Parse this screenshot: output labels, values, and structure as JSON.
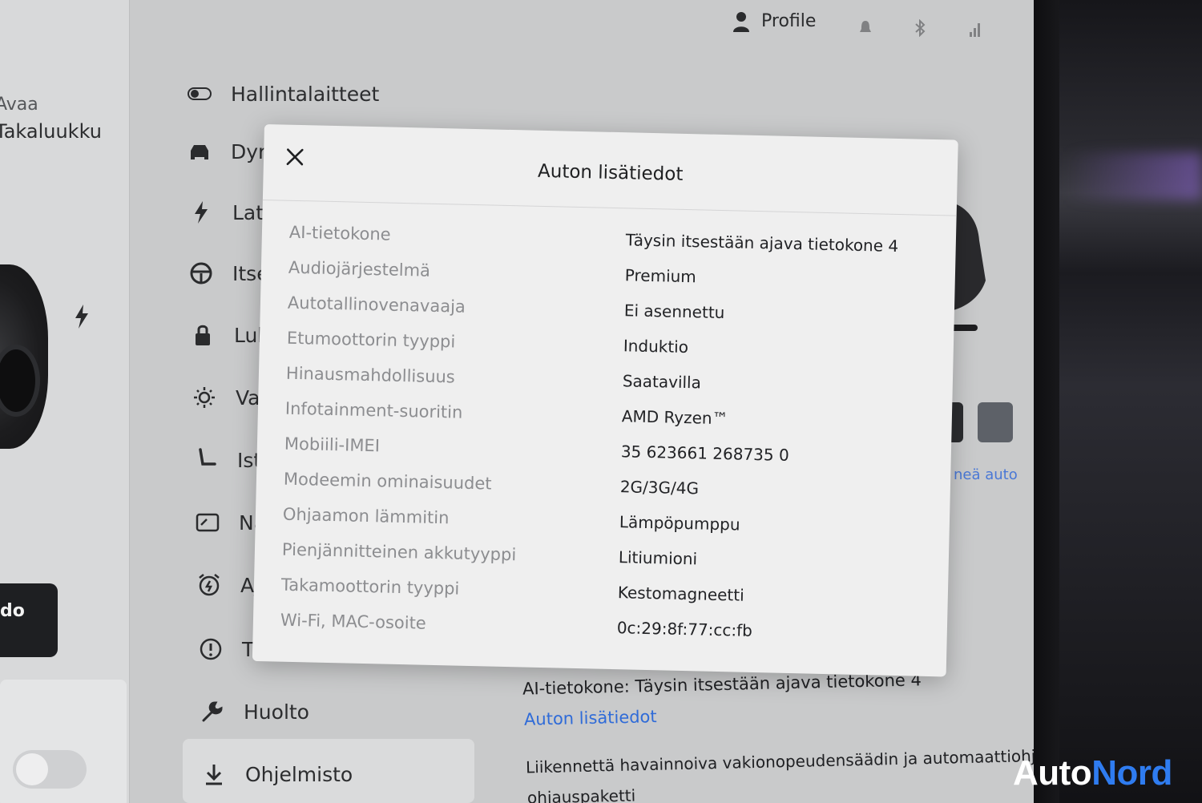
{
  "status_bar": {
    "profile_label": "Profile"
  },
  "left_panel": {
    "open_label": "Avaa",
    "trunk_label": "Takaluukku",
    "button_label": "do"
  },
  "menu": {
    "items": [
      {
        "label": "Hallintalaitteet",
        "icon": "toggle-icon"
      },
      {
        "label": "Dyr",
        "icon": "car-icon"
      },
      {
        "label": "Lat",
        "icon": "bolt-icon"
      },
      {
        "label": "Itse",
        "icon": "steering-wheel-icon"
      },
      {
        "label": "Luk",
        "icon": "lock-icon"
      },
      {
        "label": "Val",
        "icon": "light-icon"
      },
      {
        "label": "Istu",
        "icon": "seat-icon"
      },
      {
        "label": "Näy",
        "icon": "display-icon"
      },
      {
        "label": "Aja",
        "icon": "alarm-icon"
      },
      {
        "label": "Tur",
        "icon": "warning-icon"
      },
      {
        "label": "Huolto",
        "icon": "wrench-icon"
      },
      {
        "label": "Ohjelmisto",
        "icon": "download-icon"
      }
    ],
    "selected": "Ohjelmisto"
  },
  "content": {
    "ai_computer_line": "AI-tietokone: Täysin itsestään ajava tietokone 4",
    "details_link": "Auton lisätiedot",
    "cruise_line": "Liikennettä havainnoiva vakionopeudensäädin ja automaattiohjau",
    "partial_line": "ohjauspaketti",
    "partial_link": "neä auto"
  },
  "modal": {
    "title": "Auton lisätiedot",
    "rows": [
      {
        "label": "AI-tietokone",
        "value": "Täysin itsestään ajava tietokone 4"
      },
      {
        "label": "Audiojärjestelmä",
        "value": "Premium"
      },
      {
        "label": "Autotallinovenavaaja",
        "value": "Ei asennettu"
      },
      {
        "label": "Etumoottorin tyyppi",
        "value": "Induktio"
      },
      {
        "label": "Hinausmahdollisuus",
        "value": "Saatavilla"
      },
      {
        "label": "Infotainment-suoritin",
        "value": "AMD Ryzen™"
      },
      {
        "label": "Mobiili-IMEI",
        "value": "35 623661 268735 0"
      },
      {
        "label": "Modeemin ominaisuudet",
        "value": "2G/3G/4G"
      },
      {
        "label": "Ohjaamon lämmitin",
        "value": "Lämpöpumppu"
      },
      {
        "label": "Pienjännitteinen akkutyyppi",
        "value": "Litiumioni"
      },
      {
        "label": "Takamoottorin tyyppi",
        "value": "Kestomagneetti"
      },
      {
        "label": "Wi-Fi, MAC-osoite",
        "value": "0c:29:8f:77:cc:fb"
      }
    ]
  },
  "watermark": {
    "part1": "Auto",
    "part2": "Nord"
  }
}
